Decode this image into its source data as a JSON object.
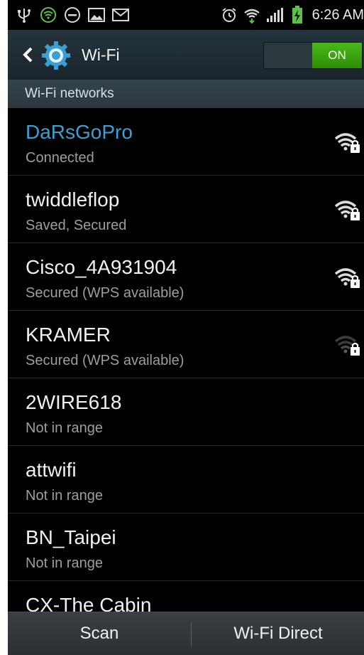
{
  "status_bar": {
    "time": "6:26 AM",
    "left_icons": [
      "usb-icon",
      "wifi-notification-icon",
      "do-not-disturb-icon",
      "image-icon",
      "gmail-icon"
    ],
    "right_icons": [
      "alarm-icon",
      "wifi-signal-icon",
      "cell-signal-icon",
      "battery-charging-icon"
    ]
  },
  "action_bar": {
    "title": "Wi-Fi",
    "toggle_label": "ON",
    "accent_color": "#3a9fd5",
    "toggle_color": "#3ea411"
  },
  "section": {
    "title": "Wi-Fi networks"
  },
  "networks": [
    {
      "name": "DaRsGoPro",
      "status": "Connected",
      "signal_icon": "wifi-secured-icon",
      "signal_strength": "full"
    },
    {
      "name": "twiddleflop",
      "status": "Saved, Secured",
      "signal_icon": "wifi-secured-icon",
      "signal_strength": "full"
    },
    {
      "name": "Cisco_4A931904",
      "status": "Secured (WPS available)",
      "signal_icon": "wifi-secured-icon",
      "signal_strength": "full"
    },
    {
      "name": "KRAMER",
      "status": "Secured (WPS available)",
      "signal_icon": "wifi-secured-weak-icon",
      "signal_strength": "weak"
    },
    {
      "name": "2WIRE618",
      "status": "Not in range"
    },
    {
      "name": "attwifi",
      "status": "Not in range"
    },
    {
      "name": "BN_Taipei",
      "status": "Not in range"
    },
    {
      "name": "CX-The Cabin",
      "status": ""
    }
  ],
  "bottom_bar": {
    "scan_label": "Scan",
    "wifi_direct_label": "Wi-Fi Direct"
  }
}
